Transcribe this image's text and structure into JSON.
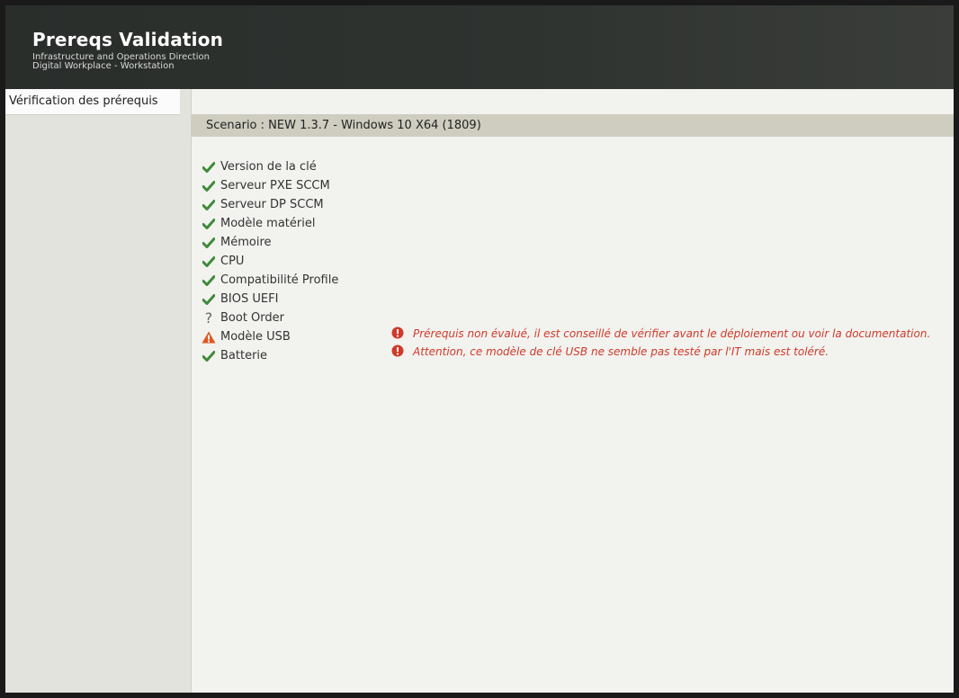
{
  "header": {
    "title": "Prereqs Validation",
    "subtitle_line1": "Infrastructure and Operations Direction",
    "subtitle_line2": "Digital Workplace - Workstation"
  },
  "sidebar": {
    "items": [
      {
        "label": "Vérification des prérequis"
      }
    ]
  },
  "main": {
    "scenario": "Scenario : NEW 1.3.7 - Windows 10 X64 (1809)",
    "checks": [
      {
        "label": "Version de la clé",
        "status": "ok",
        "icon": "check-icon"
      },
      {
        "label": "Serveur PXE SCCM",
        "status": "ok",
        "icon": "check-icon"
      },
      {
        "label": "Serveur DP SCCM",
        "status": "ok",
        "icon": "check-icon"
      },
      {
        "label": "Modèle matériel",
        "status": "ok",
        "icon": "check-icon"
      },
      {
        "label": "Mémoire",
        "status": "ok",
        "icon": "check-icon"
      },
      {
        "label": "CPU",
        "status": "ok",
        "icon": "check-icon"
      },
      {
        "label": "Compatibilité Profile",
        "status": "ok",
        "icon": "check-icon"
      },
      {
        "label": "BIOS UEFI",
        "status": "ok",
        "icon": "check-icon"
      },
      {
        "label": "Boot Order",
        "status": "unknown",
        "icon": "question-icon"
      },
      {
        "label": "Modèle USB",
        "status": "warning",
        "icon": "warning-icon"
      },
      {
        "label": "Batterie",
        "status": "ok",
        "icon": "check-icon"
      }
    ],
    "messages": [
      {
        "text": "Prérequis non évalué, il est conseillé de vérifier avant le déploiement ou voir la documentation.",
        "icon": "error-icon"
      },
      {
        "text": "Attention, ce modèle de clé USB ne semble pas testé par l'IT mais est toléré.",
        "icon": "error-icon"
      }
    ]
  },
  "colors": {
    "ok": "#3f8a3a",
    "warning": "#e0561f",
    "error": "#d03a2a",
    "header_bg": "#2f3330"
  }
}
